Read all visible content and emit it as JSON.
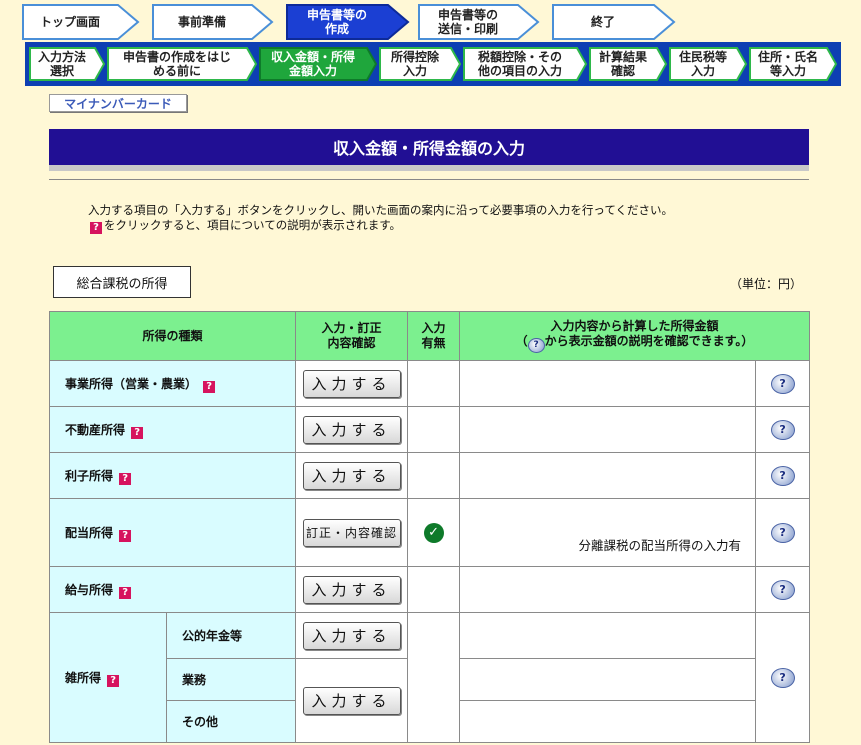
{
  "steps_main": [
    {
      "label": "トップ画面",
      "active": false
    },
    {
      "label": "事前準備",
      "active": false
    },
    {
      "label": "申告書等の\n作成",
      "active": true
    },
    {
      "label": "申告書等の\n送信・印刷",
      "active": false
    },
    {
      "label": "終了",
      "active": false
    }
  ],
  "steps_sub": [
    {
      "label": "入力方法\n選択",
      "active": false
    },
    {
      "label": "申告書の作成をはじ\nめる前に",
      "active": false
    },
    {
      "label": "収入金額・所得\n金額入力",
      "active": true
    },
    {
      "label": "所得控除\n入力",
      "active": false
    },
    {
      "label": "税額控除・その\n他の項目の入力",
      "active": false
    },
    {
      "label": "計算結果\n確認",
      "active": false
    },
    {
      "label": "住民税等\n入力",
      "active": false
    },
    {
      "label": "住所・氏名\n等入力",
      "active": false
    }
  ],
  "mynumber_label": "マイナンバーカード",
  "page_title": "収入金額・所得金額の入力",
  "description": {
    "line1": "入力する項目の「入力する」ボタンをクリックし、開いた画面の案内に沿って必要事項の入力を行ってください。",
    "line2_qmark": "?",
    "line2": "をクリックすると、項目についての説明が表示されます。"
  },
  "section_label": "総合課税の所得",
  "unit_label": "（単位：円）",
  "table": {
    "header": {
      "kind": "所得の種類",
      "action": "入力・訂正\n内容確認",
      "status": "入力\n有無",
      "amount_line1": "入力内容から計算した所得金額",
      "amount_line2_pre": "（",
      "amount_line2_post": "から表示金額の説明を確認できます。）"
    },
    "rows": [
      {
        "name": "事業所得（営業・農業）",
        "button": "入力する",
        "entered": false,
        "note": ""
      },
      {
        "name": "不動産所得",
        "button": "入力する",
        "entered": false,
        "note": ""
      },
      {
        "name": "利子所得",
        "button": "入力する",
        "entered": false,
        "note": ""
      },
      {
        "name": "配当所得",
        "button": "訂正・内容確認",
        "entered": true,
        "note": "分離課税の配当所得の入力有"
      },
      {
        "name": "給与所得",
        "button": "入力する",
        "entered": false,
        "note": ""
      }
    ],
    "misc": {
      "name": "雑所得",
      "sub1": "公的年金等",
      "sub1_button": "入力する",
      "sub2": "業務",
      "sub3": "その他",
      "sub23_button": "入力する"
    }
  },
  "icons": {
    "help_glyph": "?",
    "qmark_glyph": "?",
    "check_glyph": "✓"
  },
  "colors": {
    "page_bg": "#fff8d6",
    "title_bar": "#210f94",
    "step_active": "#1b3fd3",
    "header_green": "#7cf08f",
    "row_cyan": "#d9fcff"
  }
}
